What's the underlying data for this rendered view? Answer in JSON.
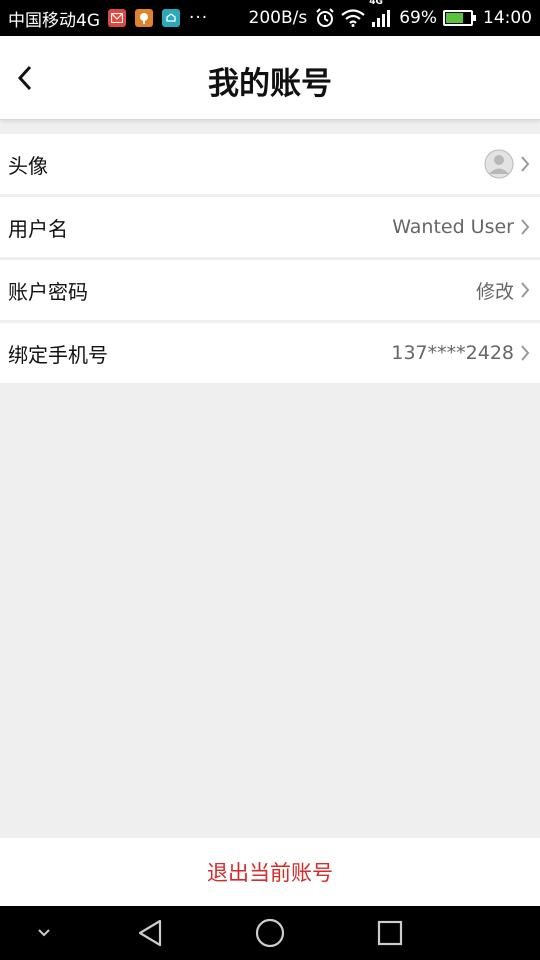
{
  "status_bar": {
    "carrier": "中国移动4G",
    "more": "···",
    "net_speed": "200B/s",
    "network_type": "4G",
    "battery": "69%",
    "battery_level": 0.69,
    "time": "14:00",
    "notification_icons": [
      "mail-app-icon",
      "gift-app-icon",
      "cloud-app-icon"
    ]
  },
  "header": {
    "title": "我的账号",
    "back_icon": "back-arrow-icon"
  },
  "rows": [
    {
      "label": "头像",
      "value": "",
      "icon": "avatar-icon"
    },
    {
      "label": "用户名",
      "value": "Wanted User"
    },
    {
      "label": "账户密码",
      "value": "修改"
    },
    {
      "label": "绑定手机号",
      "value": "137****2428"
    }
  ],
  "logout": {
    "label": "退出当前账号"
  },
  "nav_bar": {
    "icons": [
      "hide-keyboard-icon",
      "back-triangle-icon",
      "home-circle-icon",
      "recents-square-icon"
    ]
  },
  "colors": {
    "accent_red": "#d42b2b",
    "background": "#efefef",
    "battery_green": "#58c23a"
  }
}
